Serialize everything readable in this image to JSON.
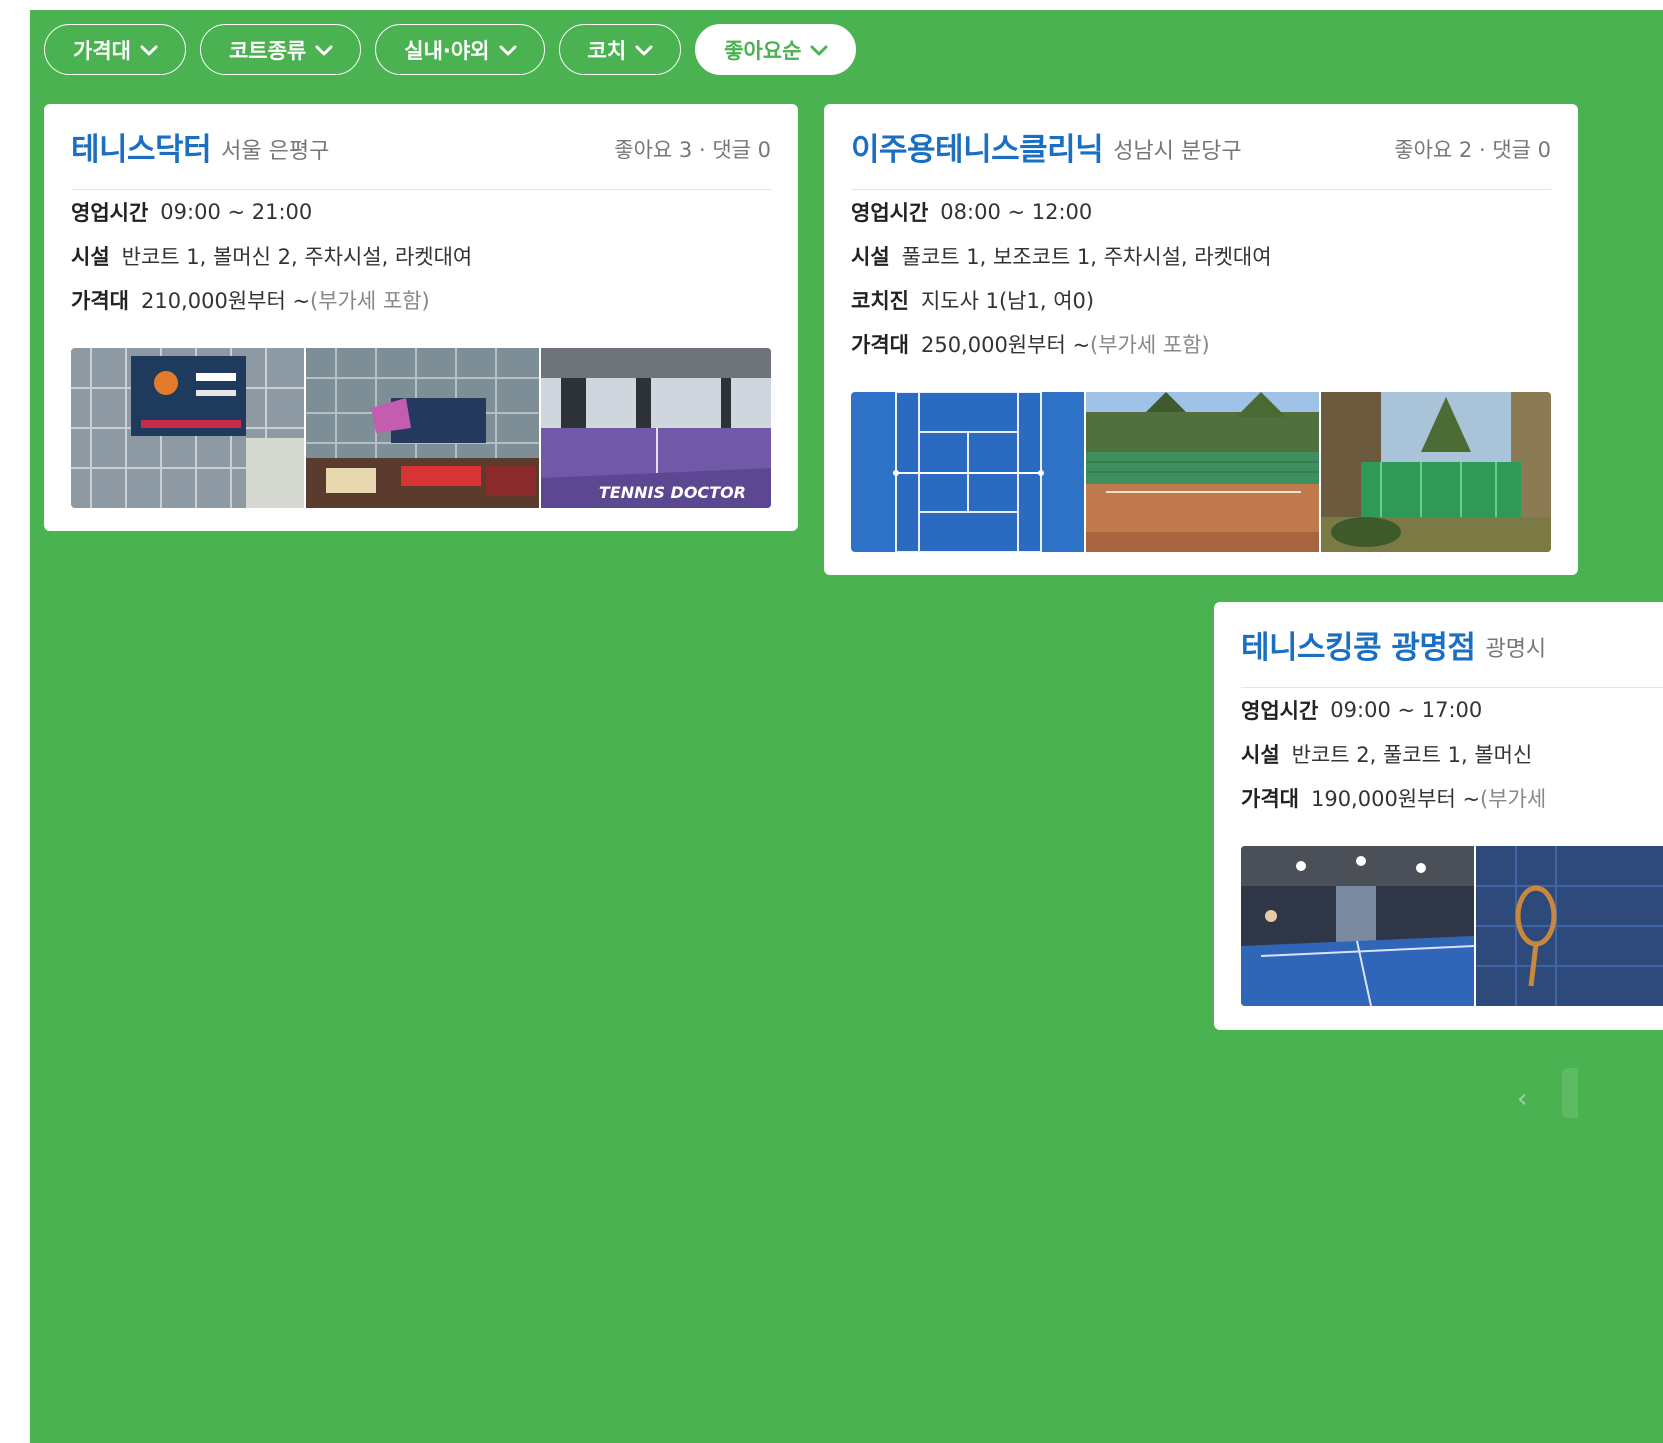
{
  "filters": [
    {
      "label": "가격대",
      "active": false
    },
    {
      "label": "코트종류",
      "active": false
    },
    {
      "label": "실내·야외",
      "active": false
    },
    {
      "label": "코치",
      "active": false
    },
    {
      "label": "좋아요순",
      "active": true
    }
  ],
  "cards": [
    {
      "name": "테니스닥터",
      "region": "서울 은평구",
      "stats": "좋아요 3 · 댓글 0",
      "hours_label": "영업시간",
      "hours": "09:00 ~ 21:00",
      "facility_label": "시설",
      "facility": "반코트 1, 볼머신 2, 주차시설, 라켓대여",
      "price_label": "가격대",
      "price": "210,000원부터 ~",
      "price_note": "(부가세 포함)",
      "photo_caption": "TENNIS DOCTOR"
    },
    {
      "name": "이주용테니스클리닉",
      "region": "성남시 분당구",
      "stats": "좋아요 2 · 댓글 0",
      "hours_label": "영업시간",
      "hours": "08:00 ~ 12:00",
      "facility_label": "시설",
      "facility": "풀코트 1, 보조코트 1, 주차시설, 라켓대여",
      "coach_label": "코치진",
      "coach": "지도사 1(남1, 여0)",
      "price_label": "가격대",
      "price": "250,000원부터 ~",
      "price_note": "(부가세 포함)"
    },
    {
      "name": "테니스킹콩 광명점",
      "region": "광명시",
      "hours_label": "영업시간",
      "hours": "09:00 ~ 17:00",
      "facility_label": "시설",
      "facility": "반코트 2, 풀코트 1, 볼머신",
      "price_label": "가격대",
      "price": "190,000원부터 ~",
      "price_note": "(부가세"
    }
  ],
  "pager": {
    "prev": "‹"
  },
  "colors": {
    "background": "#4bb251",
    "title": "#1a6fc2",
    "chip_border": "#ffffff"
  }
}
